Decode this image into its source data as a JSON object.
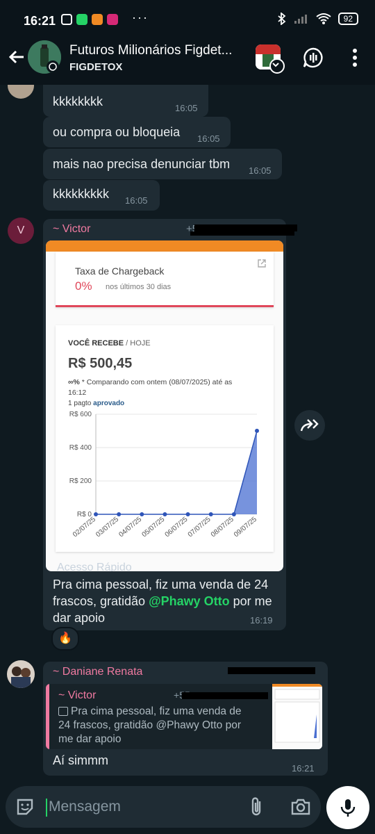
{
  "status": {
    "time": "16:21",
    "battery": "92"
  },
  "header": {
    "title": "Futuros Milionários Figdet...",
    "subtitle": "FIGDETOX"
  },
  "messages": {
    "top_partial_time": "16:05",
    "m1": {
      "text": "kkkkkkkk",
      "time": "16:05"
    },
    "m2": {
      "text": "ou compra ou bloqueia",
      "time": "16:05"
    },
    "m3": {
      "text": "mais nao precisa denunciar tbm",
      "time": "16:05"
    },
    "m4": {
      "text": "kkkkkkkkk",
      "time": "16:05"
    },
    "victor": {
      "avatar_letter": "V",
      "sender": "~ Victor",
      "phone_prefix": "+5",
      "caption_line1": "Pra cima pessoal, fiz uma venda de 24",
      "caption_line2a": "frascos, gratidão ",
      "mention": "@Phawy Otto",
      "caption_line2b": "  por me",
      "caption_line3": "dar apoio",
      "time": "16:19",
      "reaction": "🔥"
    },
    "daniane": {
      "sender": "~ Daniane Renata",
      "quote_sender": "~ Victor",
      "quote_phone_prefix": "+55",
      "quote_line1": "Pra cima pessoal, fiz uma venda de",
      "quote_line2": "24 frascos, gratidão @Phawy Otto  por",
      "quote_line3": "me dar apoio",
      "text": "Aí simmm",
      "time": "16:21"
    }
  },
  "screenshot": {
    "chargeback_title": "Taxa de Chargeback",
    "chargeback_value": "0%",
    "chargeback_period": "nos últimos 30 dias",
    "receive_label": "VOCÊ RECEBE",
    "receive_sep": " / HOJE",
    "amount": "R$ 500,45",
    "compare_pct": "∞%",
    "compare_text": " * Comparando com ontem (08/07/2025) até as",
    "compare_time": "16:12",
    "paid_prefix": "1 pagto ",
    "paid_status": "aprovado",
    "footer_partial": "Acesso Rápido"
  },
  "chart_data": {
    "type": "area",
    "categories": [
      "02/07/25",
      "03/07/25",
      "04/07/25",
      "05/07/25",
      "06/07/25",
      "07/07/25",
      "08/07/25",
      "09/07/25"
    ],
    "values": [
      0,
      0,
      0,
      0,
      0,
      0,
      0,
      500.45
    ],
    "y_ticks": [
      "R$ 0",
      "R$ 200",
      "R$ 400",
      "R$ 600"
    ],
    "ylim": [
      0,
      600
    ],
    "color": "#4a6fd1"
  },
  "input": {
    "placeholder": "Mensagem"
  },
  "colors": {
    "accent": "#25d366",
    "sender_pink": "#f07aa1",
    "mention_green": "#53bdeb"
  }
}
